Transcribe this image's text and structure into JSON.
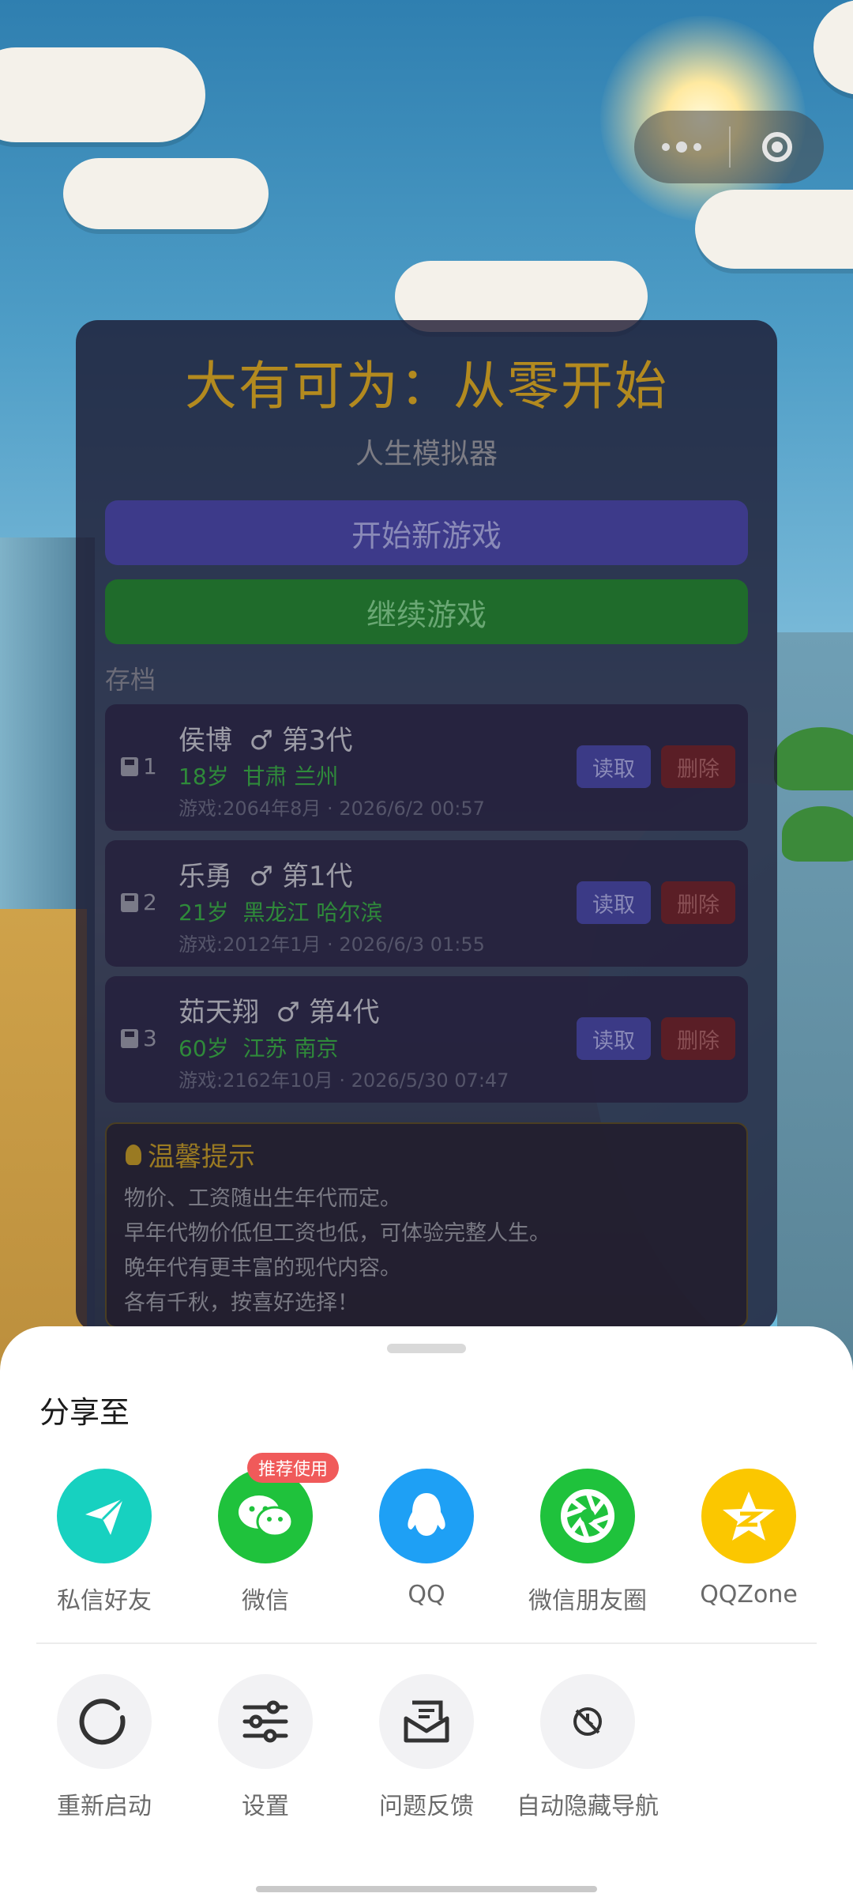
{
  "capsule": {
    "more_icon": "more-dots-icon",
    "close_icon": "target-close-icon"
  },
  "game": {
    "title": "大有可为：从零开始",
    "subtitle": "人生模拟器",
    "new_game": "开始新游戏",
    "continue_game": "继续游戏",
    "saves_header": "存档",
    "saves": [
      {
        "slot": "1",
        "name": "侯博",
        "gender_icon": "♂",
        "gen": "第3代",
        "age": "18岁",
        "place": "甘肃 兰州",
        "time": "游戏:2064年8月 · 2026/6/2 00:57",
        "read": "读取",
        "delete": "删除"
      },
      {
        "slot": "2",
        "name": "乐勇",
        "gender_icon": "♂",
        "gen": "第1代",
        "age": "21岁",
        "place": "黑龙江 哈尔滨",
        "time": "游戏:2012年1月 · 2026/6/3 01:55",
        "read": "读取",
        "delete": "删除"
      },
      {
        "slot": "3",
        "name": "茹天翔",
        "gender_icon": "♂",
        "gen": "第4代",
        "age": "60岁",
        "place": "江苏 南京",
        "time": "游戏:2162年10月 · 2026/5/30 07:47",
        "read": "读取",
        "delete": "删除"
      }
    ],
    "tips": {
      "title": "温馨提示",
      "lines": [
        "物价、工资随出生年代而定。",
        "早年代物价低但工资也低，可体验完整人生。",
        "晚年代有更丰富的现代内容。",
        "各有千秋，按喜好选择！"
      ]
    }
  },
  "share": {
    "title": "分享至",
    "badge": "推荐使用",
    "targets": [
      {
        "label": "私信好友",
        "icon": "paper-plane-icon",
        "color": "#17d1c0"
      },
      {
        "label": "微信",
        "icon": "wechat-icon",
        "color": "#1fc23c"
      },
      {
        "label": "QQ",
        "icon": "qq-penguin-icon",
        "color": "#1ea0f5"
      },
      {
        "label": "微信朋友圈",
        "icon": "moments-shutter-icon",
        "color": "#1fc23c"
      },
      {
        "label": "QQZone",
        "icon": "qzone-star-icon",
        "color": "#fbc700"
      }
    ],
    "actions": [
      {
        "label": "重新启动",
        "icon": "restart-icon"
      },
      {
        "label": "设置",
        "icon": "settings-sliders-icon"
      },
      {
        "label": "问题反馈",
        "icon": "feedback-envelope-icon"
      },
      {
        "label": "自动隐藏导航",
        "icon": "hide-navigation-icon"
      }
    ]
  }
}
